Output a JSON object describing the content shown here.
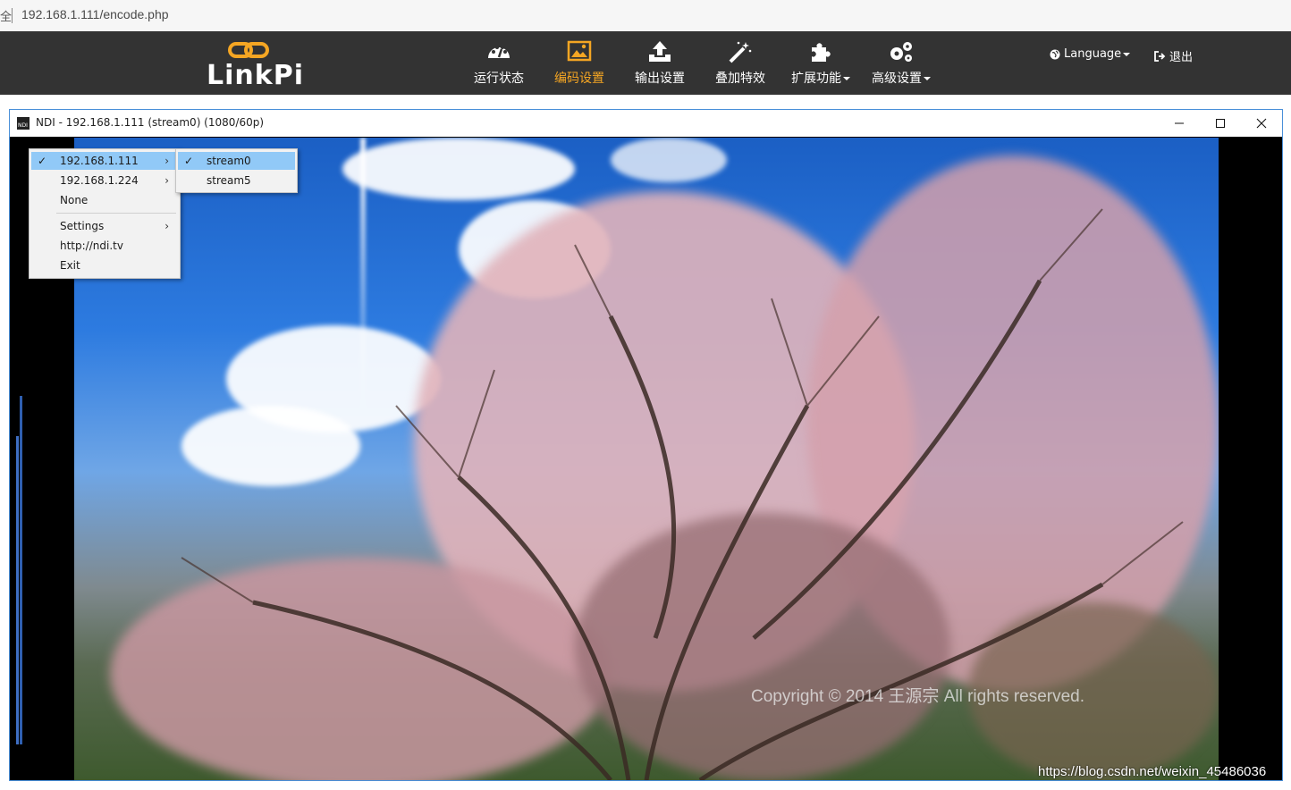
{
  "browser": {
    "edge_glyph": "全",
    "url": "192.168.1.111/encode.php"
  },
  "site": {
    "logo_text": "LinkPi",
    "nav": [
      {
        "label": "运行状态",
        "icon": "dashboard-icon",
        "active": false,
        "dropdown": false
      },
      {
        "label": "编码设置",
        "icon": "image-icon",
        "active": true,
        "dropdown": false
      },
      {
        "label": "输出设置",
        "icon": "upload-icon",
        "active": false,
        "dropdown": false
      },
      {
        "label": "叠加特效",
        "icon": "magic-wand-icon",
        "active": false,
        "dropdown": false
      },
      {
        "label": "扩展功能",
        "icon": "puzzle-icon",
        "active": false,
        "dropdown": true
      },
      {
        "label": "高级设置",
        "icon": "gears-icon",
        "active": false,
        "dropdown": true
      }
    ],
    "language_label": "Language",
    "logout_label": "退出",
    "accent_color": "#f5a623",
    "nav_bg": "#333333"
  },
  "ndi_window": {
    "title": "NDI - 192.168.1.111 (stream0) (1080/60p)",
    "app_icon_text": "NDI",
    "video_overlay_text": "Copyright © 2014 王源宗 All rights reserved."
  },
  "context_menu": {
    "items": [
      {
        "label": "192.168.1.111",
        "checked": true,
        "submenu": true,
        "selected": true
      },
      {
        "label": "192.168.1.224",
        "checked": false,
        "submenu": true,
        "selected": false
      },
      {
        "label": "None",
        "checked": false,
        "submenu": false,
        "selected": false
      },
      {
        "label": "Settings",
        "checked": false,
        "submenu": true,
        "selected": false
      },
      {
        "label": "http://ndi.tv",
        "checked": false,
        "submenu": false,
        "selected": false
      },
      {
        "label": "Exit",
        "checked": false,
        "submenu": false,
        "selected": false
      }
    ],
    "submenu_items": [
      {
        "label": "stream0",
        "checked": true,
        "selected": true
      },
      {
        "label": "stream5",
        "checked": false,
        "selected": false
      }
    ],
    "check_glyph": "✓",
    "arrow_glyph": "›"
  },
  "watermark": "https://blog.csdn.net/weixin_45486036"
}
